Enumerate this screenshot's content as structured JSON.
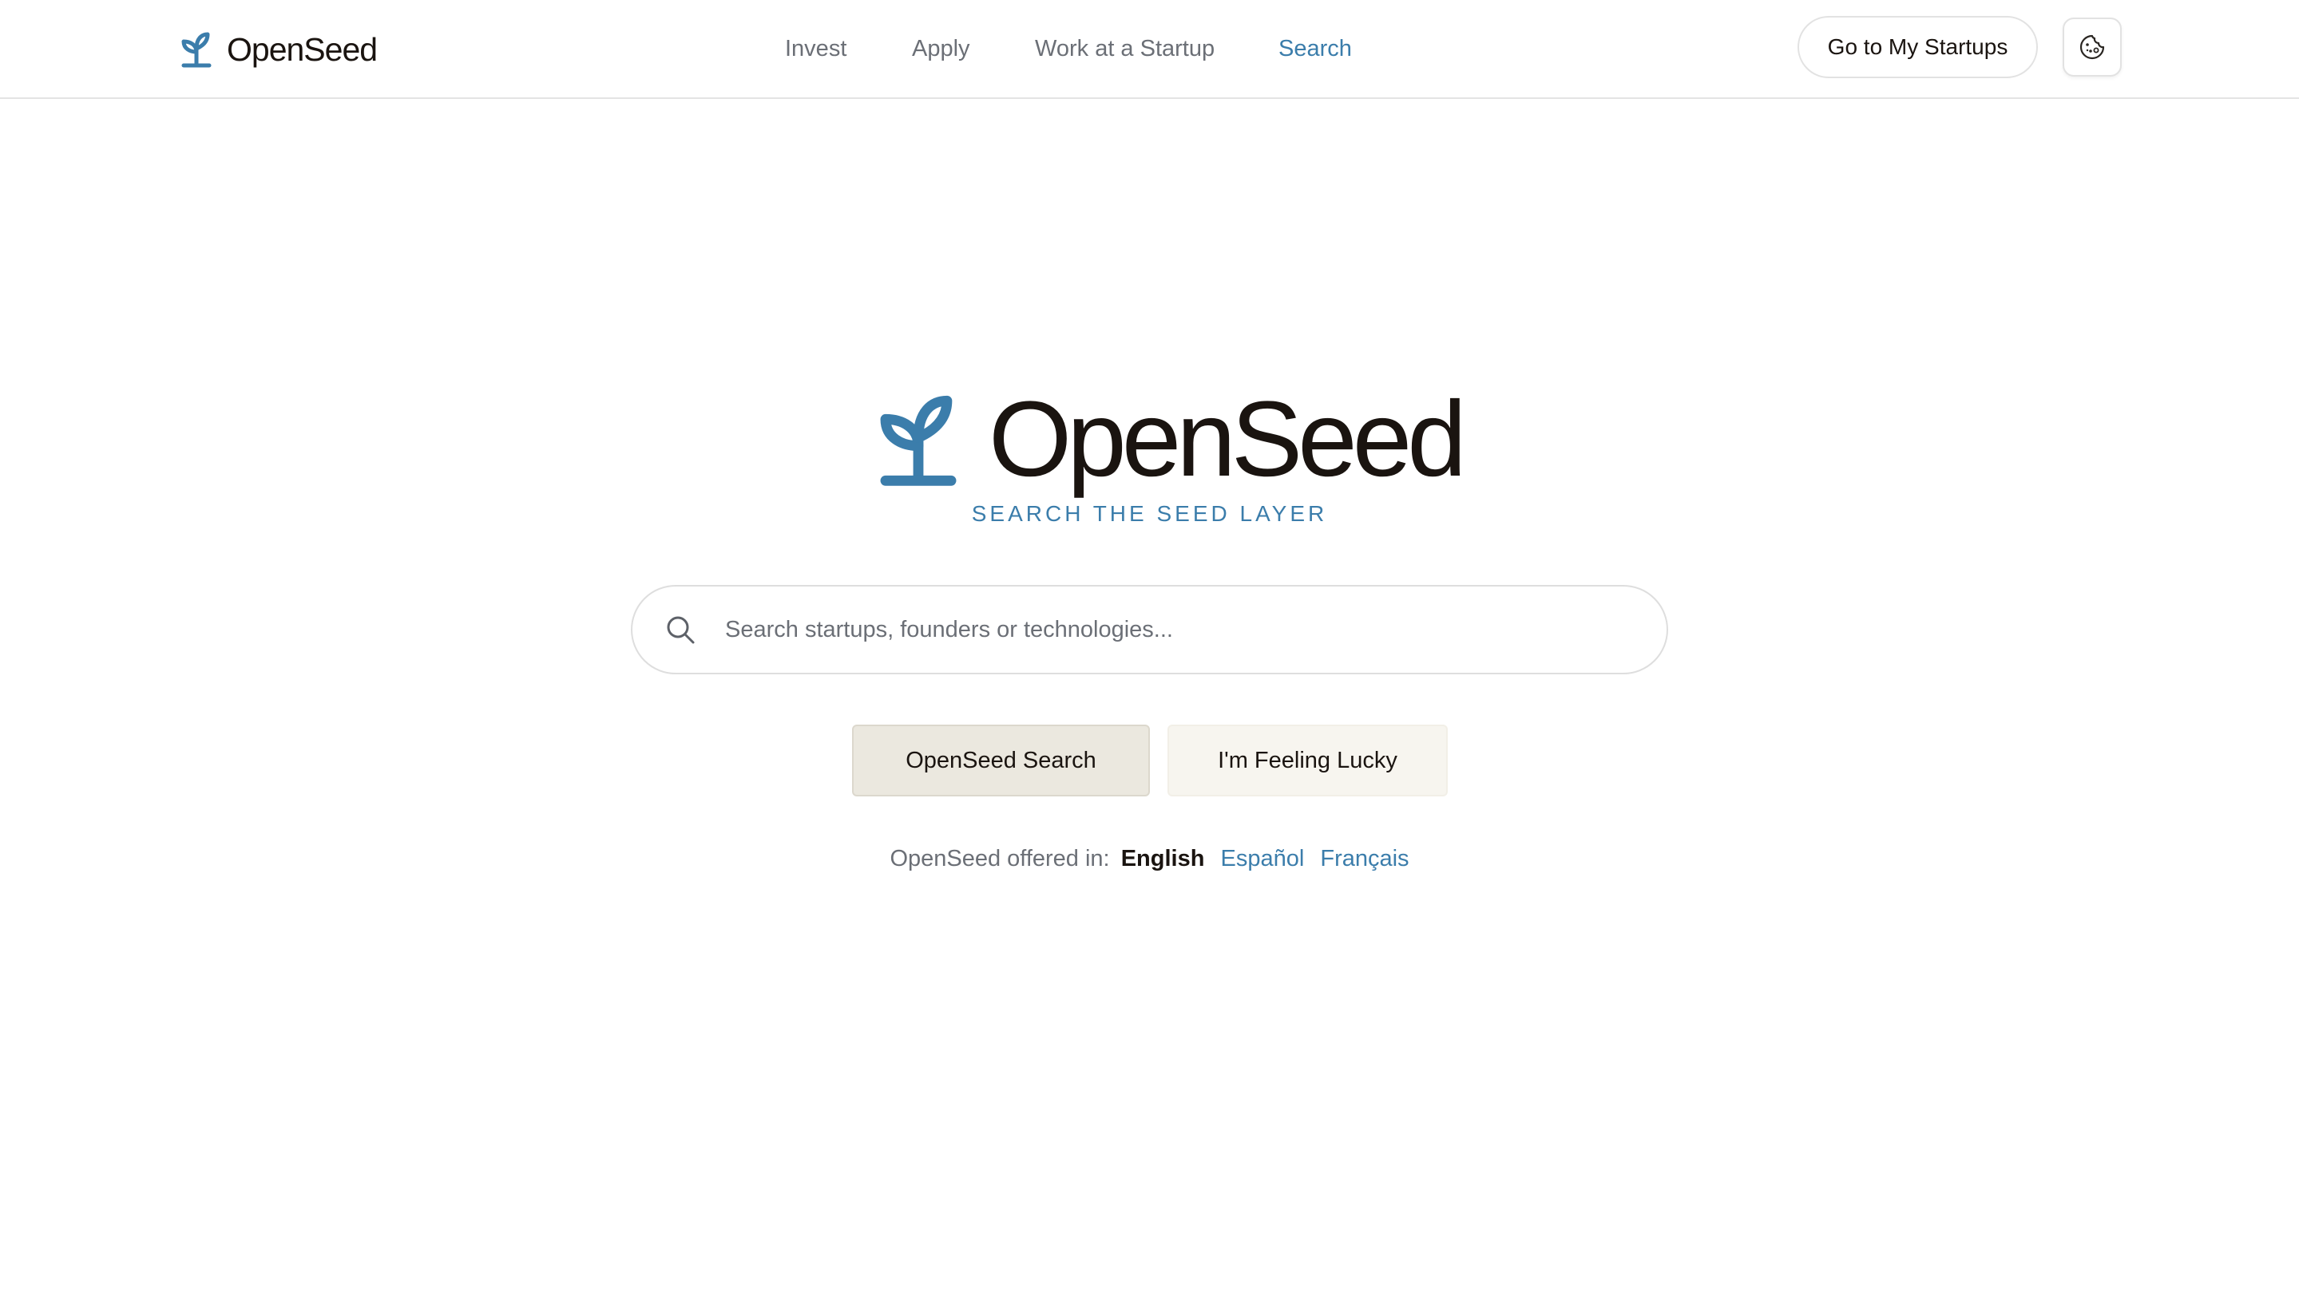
{
  "header": {
    "brand": "OpenSeed",
    "nav": [
      {
        "label": "Invest"
      },
      {
        "label": "Apply"
      },
      {
        "label": "Work at a Startup"
      },
      {
        "label": "Search",
        "active": true
      }
    ],
    "my_startups_label": "Go to My Startups",
    "settings_icon": "cookie-icon"
  },
  "hero": {
    "title": "OpenSeed",
    "tagline": "SEARCH THE SEED LAYER",
    "logo_icon": "sprout-icon"
  },
  "search": {
    "icon": "search-icon",
    "value": "",
    "placeholder": "Search startups, founders or technologies..."
  },
  "buttons": {
    "search_label": "OpenSeed Search",
    "lucky_label": "I'm Feeling Lucky"
  },
  "languages": {
    "prefix": "OpenSeed offered in:",
    "current": "English",
    "others": [
      "Español",
      "Français"
    ]
  },
  "colors": {
    "accent": "#3b7dab",
    "text": "#1a1410",
    "muted": "#6b6f76",
    "button_bg": "#ebe8df",
    "button_alt_bg": "#f7f5ef"
  }
}
